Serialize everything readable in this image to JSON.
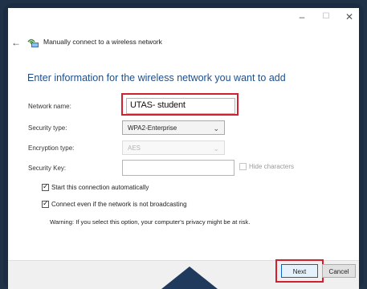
{
  "window": {
    "back_glyph": "←",
    "title": "Manually connect to a wireless network",
    "minimize": "–",
    "maximize": "☐",
    "close": "✕"
  },
  "form": {
    "heading": "Enter information for the wireless network you want to add",
    "network_name_label": "Network name:",
    "network_name_value": "UTAS- student",
    "security_type_label": "Security type:",
    "security_type_value": "WPA2-Enterprise",
    "encryption_type_label": "Encryption type:",
    "encryption_type_value": "AES",
    "security_key_label": "Security Key:",
    "security_key_value": "",
    "hide_characters_label": "Hide characters"
  },
  "options": {
    "start_auto_label": "Start this connection automatically",
    "start_auto_checked": true,
    "connect_broadcast_label": "Connect even if the network is not broadcasting",
    "connect_broadcast_checked": true,
    "warning": "Warning: If you select this option, your computer's privacy might be at risk."
  },
  "buttons": {
    "next": "Next",
    "cancel": "Cancel"
  },
  "colors": {
    "highlight": "#d1202f",
    "heading": "#1e4f8c",
    "frame_bg": "#1f3247"
  },
  "icons": [
    "back-arrow-icon",
    "wifi-network-icon",
    "chevron-down-icon",
    "checkmark-icon"
  ]
}
